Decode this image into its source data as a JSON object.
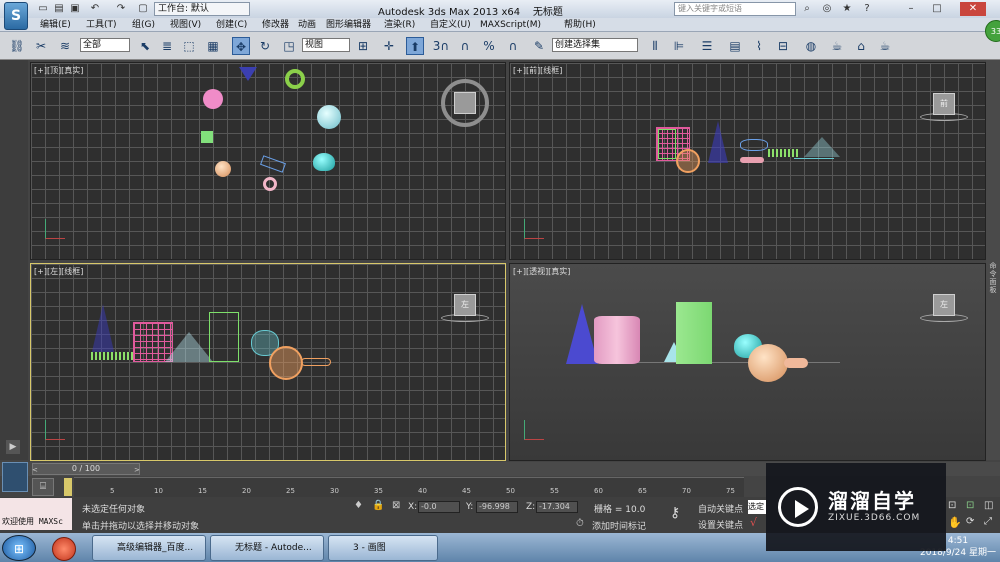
{
  "window": {
    "app_icon_letter": "S",
    "workspace_label": "工作台: 默认",
    "title": "Autodesk 3ds Max  2013 x64",
    "doc_title": "无标题",
    "search_placeholder": "键入关键字或短语"
  },
  "menu": [
    "编辑(E)",
    "工具(T)",
    "组(G)",
    "视图(V)",
    "创建(C)",
    "修改器",
    "动画",
    "图形编辑器",
    "渲染(R)",
    "自定义(U)",
    "MAXScript(M)",
    "帮助(H)"
  ],
  "toolbar": {
    "selection_filter": "全部",
    "ref_coord": "视图",
    "named_selection": "创建选择集",
    "snap_label": "3",
    "avatar_number": "33"
  },
  "viewports": {
    "top": {
      "label": "[+][顶][真实]",
      "cube_face": ""
    },
    "front": {
      "label": "[+][前][线框]",
      "cube_face": "前"
    },
    "left": {
      "label": "[+][左][线框]",
      "cube_face": "左"
    },
    "persp": {
      "label": "[+][透视][真实]",
      "cube_face": "左"
    }
  },
  "command_panel_label": "命令面板",
  "timeline": {
    "frame": "0 / 100",
    "ticks": [
      "5",
      "10",
      "15",
      "20",
      "25",
      "30",
      "35",
      "40",
      "45",
      "50",
      "55",
      "60",
      "65",
      "70",
      "75"
    ]
  },
  "status": {
    "maxscript": "欢迎使用 MAXSc",
    "selection": "未选定任何对象",
    "prompt": "单击并拖动以选择并移动对象",
    "x_label": "X:",
    "x": "-0.0",
    "y_label": "Y:",
    "y": "-96.998",
    "z_label": "Z:",
    "z": "-17.304",
    "grid": "栅格 = 10.0",
    "add_time_tag": "添加时间标记",
    "auto_key": "自动关键点",
    "set_key": "设置关键点",
    "selected": "选定"
  },
  "taskbar": {
    "items": [
      "高级编辑器_百度...",
      "无标题 - Autode...",
      "3 - 画图"
    ],
    "time": "4:51",
    "date": "2018/9/24 星期一"
  },
  "watermark": {
    "main": "溜溜自学",
    "sub": "ZIXUE.3D66.COM"
  }
}
